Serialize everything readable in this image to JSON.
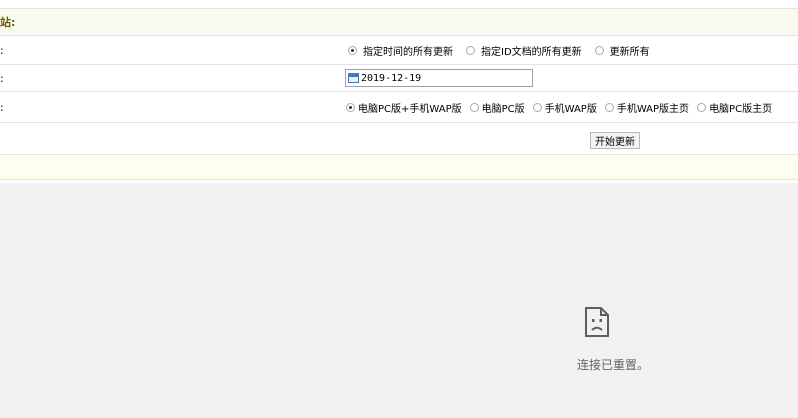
{
  "form": {
    "title_label": "站:",
    "rows": [
      {
        "label": ":",
        "options": [
          {
            "label": "指定时间的所有更新",
            "checked": true
          },
          {
            "label": "指定ID文档的所有更新",
            "checked": false
          },
          {
            "label": "更新所有",
            "checked": false
          }
        ]
      },
      {
        "label": ":",
        "date_value": "2019-12-19"
      },
      {
        "label": ":",
        "options": [
          {
            "label": "电脑PC版+手机WAP版",
            "checked": true
          },
          {
            "label": "电脑PC版",
            "checked": false
          },
          {
            "label": "手机WAP版",
            "checked": false
          },
          {
            "label": "手机WAP版主页",
            "checked": false
          },
          {
            "label": "电脑PC版主页",
            "checked": false
          }
        ]
      }
    ],
    "submit_label": "开始更新"
  },
  "error": {
    "message": "连接已重置。",
    "icon": "sad-document-icon"
  }
}
